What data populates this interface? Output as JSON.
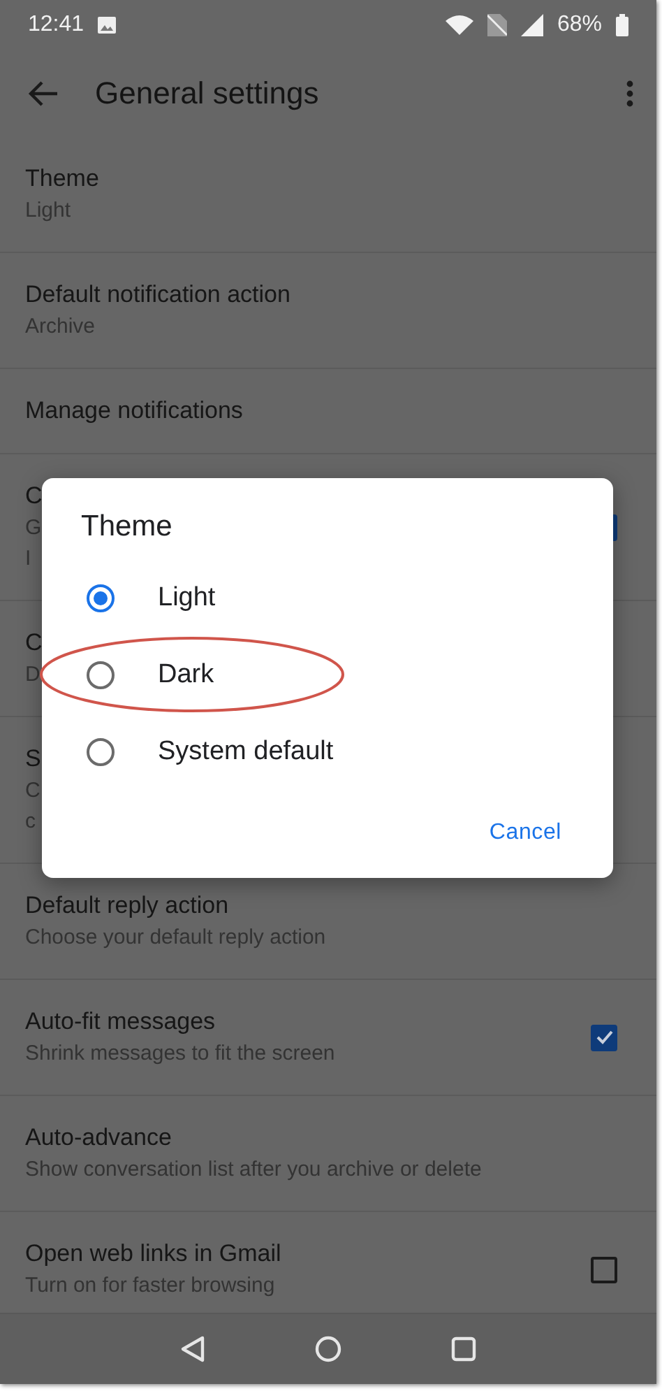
{
  "status_bar": {
    "time": "12:41",
    "battery": "68%"
  },
  "app_bar": {
    "title": "General settings"
  },
  "settings": [
    {
      "title": "Theme",
      "lines": [
        "Light"
      ]
    },
    {
      "title": "Default notification action",
      "lines": [
        "Archive"
      ]
    },
    {
      "title": "Manage notifications"
    },
    {
      "title": "C",
      "lines": [
        "G",
        "I"
      ],
      "checkbox": {
        "checked": true
      }
    },
    {
      "title": "C",
      "lines": [
        "D"
      ]
    },
    {
      "title": "S",
      "lines": [
        "C",
        "c"
      ]
    },
    {
      "title": "Default reply action",
      "lines": [
        "Choose your default reply action"
      ]
    },
    {
      "title": "Auto-fit messages",
      "lines": [
        "Shrink messages to fit the screen"
      ],
      "checkbox": {
        "checked": true
      }
    },
    {
      "title": "Auto-advance",
      "lines": [
        "Show conversation list after you archive or delete"
      ]
    },
    {
      "title": "Open web links in Gmail",
      "lines": [
        "Turn on for faster browsing"
      ],
      "checkbox": {
        "checked": false
      }
    }
  ],
  "dialog": {
    "title": "Theme",
    "options": [
      {
        "label": "Light",
        "selected": true,
        "annotated": false
      },
      {
        "label": "Dark",
        "selected": false,
        "annotated": true
      },
      {
        "label": "System default",
        "selected": false,
        "annotated": false
      }
    ],
    "buttons": [
      "Cancel"
    ]
  }
}
